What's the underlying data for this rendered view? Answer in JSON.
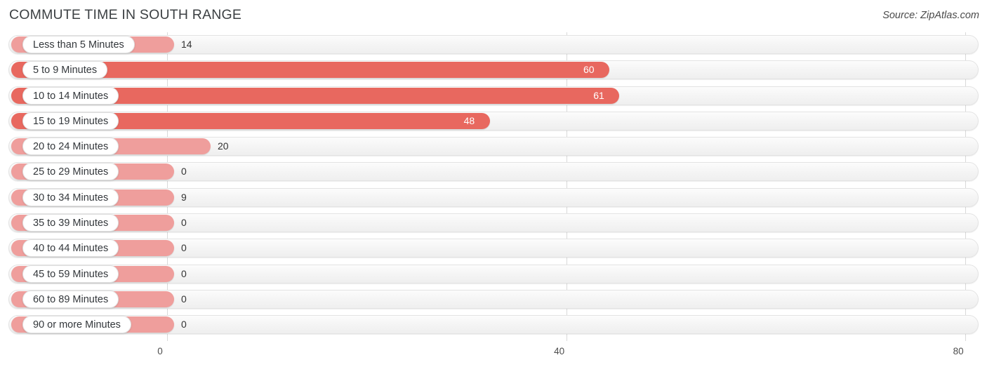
{
  "header": {
    "title": "COMMUTE TIME IN SOUTH RANGE",
    "source": "Source: ZipAtlas.com"
  },
  "colors": {
    "bar_light": "#ef9e9c",
    "bar_strong": "#e8685f",
    "track": "#f4f4f4",
    "gridline": "#d9d9d9",
    "title_text": "#3c4043"
  },
  "chart_data": {
    "type": "bar",
    "orientation": "horizontal",
    "title": "COMMUTE TIME IN SOUTH RANGE",
    "xlabel": "",
    "ylabel": "",
    "xlim": [
      0,
      80
    ],
    "xticks": [
      0,
      40,
      80
    ],
    "xticklabels": [
      "0",
      "40",
      "80"
    ],
    "grid": true,
    "legend": false,
    "categories": [
      "Less than 5 Minutes",
      "5 to 9 Minutes",
      "10 to 14 Minutes",
      "15 to 19 Minutes",
      "20 to 24 Minutes",
      "25 to 29 Minutes",
      "30 to 34 Minutes",
      "35 to 39 Minutes",
      "40 to 44 Minutes",
      "45 to 59 Minutes",
      "60 to 89 Minutes",
      "90 or more Minutes"
    ],
    "values": [
      14,
      60,
      61,
      48,
      20,
      0,
      9,
      0,
      0,
      0,
      0,
      0
    ],
    "value_labels": [
      "14",
      "60",
      "61",
      "48",
      "20",
      "0",
      "9",
      "0",
      "0",
      "0",
      "0",
      "0"
    ]
  },
  "rows": [
    {
      "label": "Less than 5 Minutes",
      "value": 14,
      "value_label": "14",
      "tone": "light",
      "label_position": "outside"
    },
    {
      "label": "5 to 9 Minutes",
      "value": 60,
      "value_label": "60",
      "tone": "strong",
      "label_position": "inside"
    },
    {
      "label": "10 to 14 Minutes",
      "value": 61,
      "value_label": "61",
      "tone": "strong",
      "label_position": "inside"
    },
    {
      "label": "15 to 19 Minutes",
      "value": 48,
      "value_label": "48",
      "tone": "strong",
      "label_position": "inside"
    },
    {
      "label": "20 to 24 Minutes",
      "value": 20,
      "value_label": "20",
      "tone": "light",
      "label_position": "outside"
    },
    {
      "label": "25 to 29 Minutes",
      "value": 0,
      "value_label": "0",
      "tone": "light",
      "label_position": "outside"
    },
    {
      "label": "30 to 34 Minutes",
      "value": 9,
      "value_label": "9",
      "tone": "light",
      "label_position": "outside"
    },
    {
      "label": "35 to 39 Minutes",
      "value": 0,
      "value_label": "0",
      "tone": "light",
      "label_position": "outside"
    },
    {
      "label": "40 to 44 Minutes",
      "value": 0,
      "value_label": "0",
      "tone": "light",
      "label_position": "outside"
    },
    {
      "label": "45 to 59 Minutes",
      "value": 0,
      "value_label": "0",
      "tone": "light",
      "label_position": "outside"
    },
    {
      "label": "60 to 89 Minutes",
      "value": 0,
      "value_label": "0",
      "tone": "light",
      "label_position": "outside"
    },
    {
      "label": "90 or more Minutes",
      "value": 0,
      "value_label": "0",
      "tone": "light",
      "label_position": "outside"
    }
  ],
  "axis": {
    "ticks": [
      {
        "label": "0",
        "value": 0
      },
      {
        "label": "40",
        "value": 40
      },
      {
        "label": "80",
        "value": 80
      }
    ]
  }
}
